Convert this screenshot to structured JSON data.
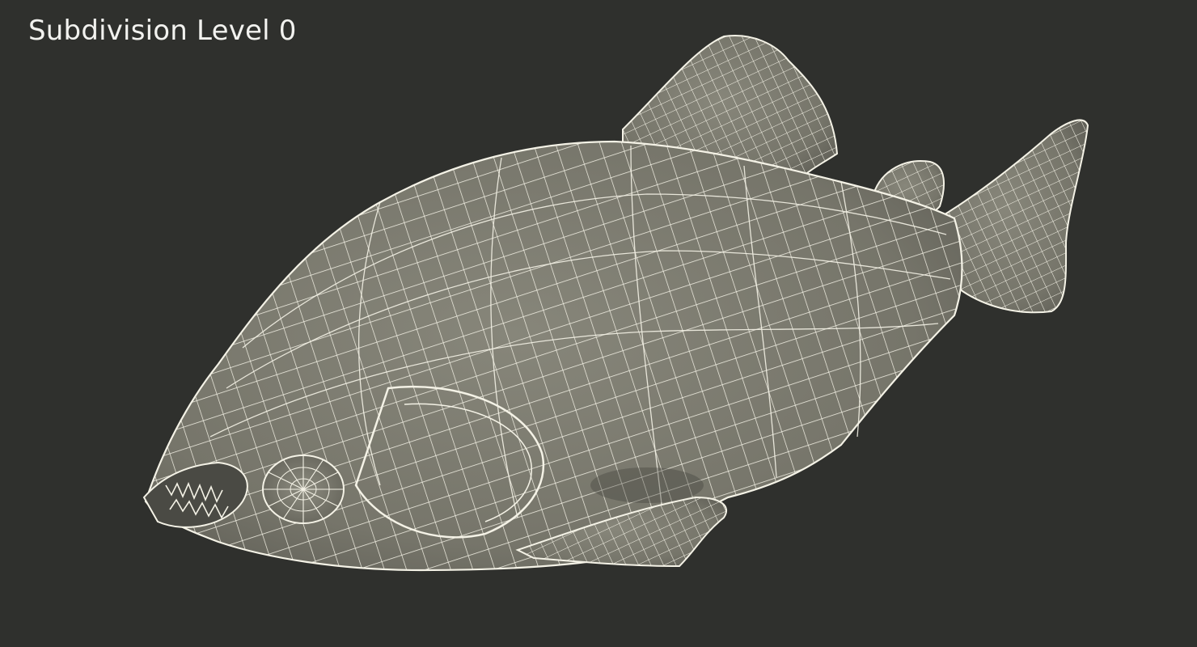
{
  "viewport": {
    "caption": "Subdivision Level 0",
    "subject": "piranha-wireframe-model",
    "colors": {
      "background": "#2f302d",
      "surface": "#7b7a6e",
      "wire": "#f4f2e6",
      "caption": "#f2f2ef"
    }
  }
}
